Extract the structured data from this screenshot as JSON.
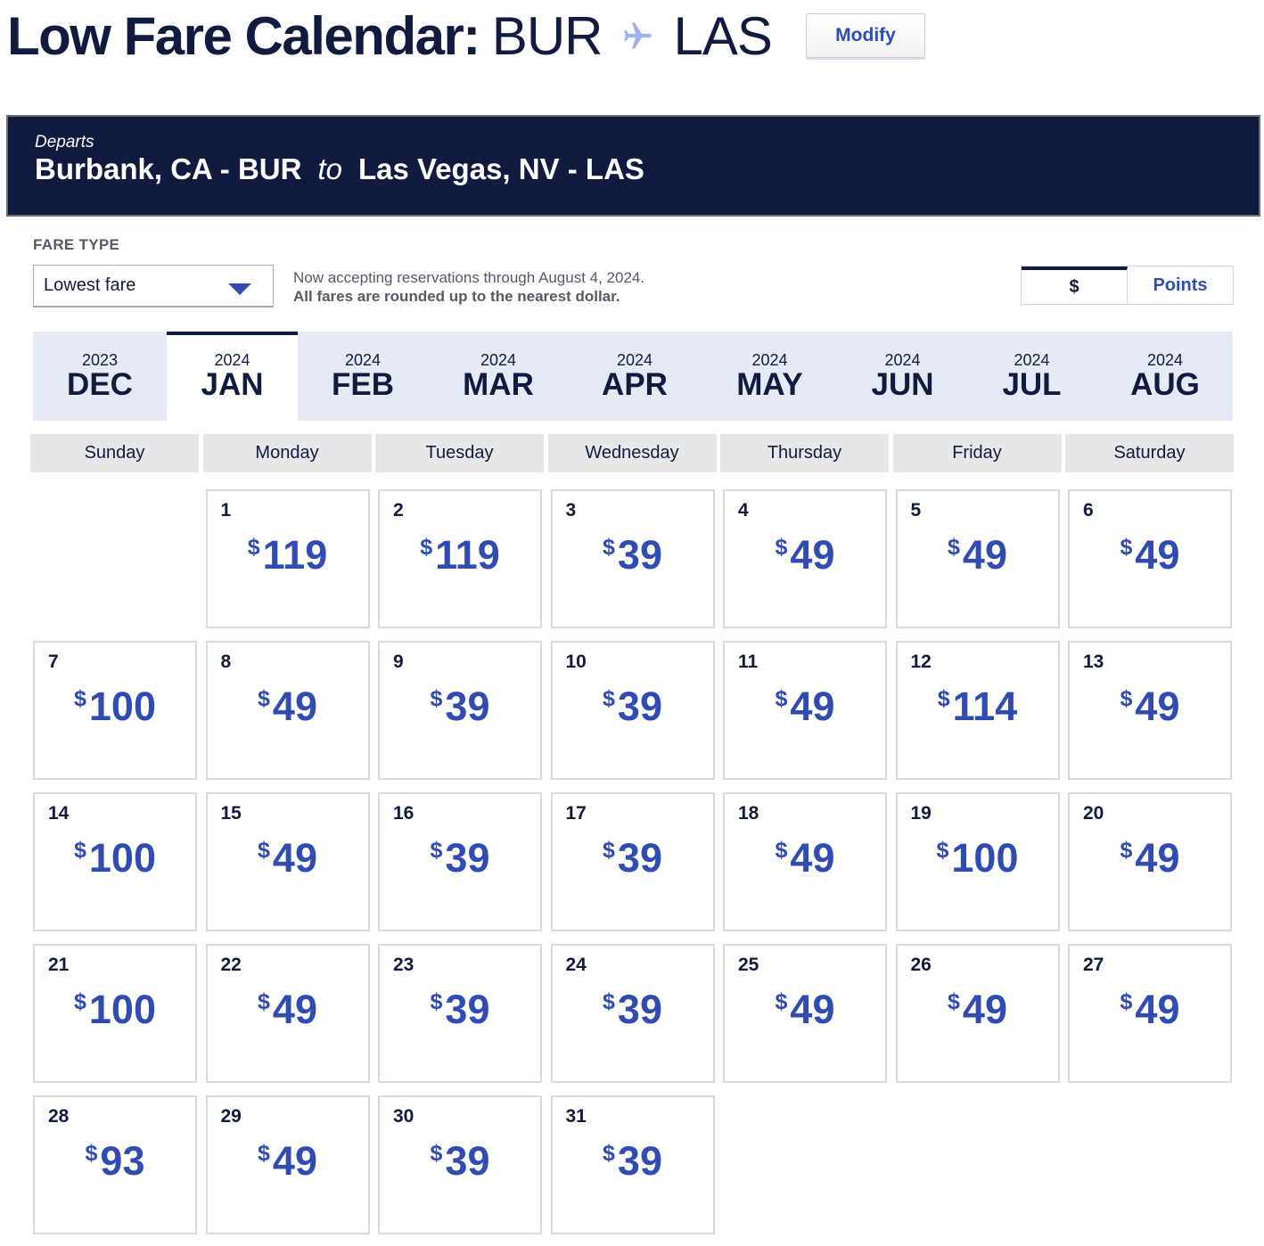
{
  "header": {
    "title_prefix": "Low Fare Calendar:",
    "origin_code": "BUR",
    "destination_code": "LAS",
    "modify_label": "Modify"
  },
  "banner": {
    "departs_label": "Departs",
    "origin": "Burbank, CA - BUR",
    "to_word": "to",
    "destination": "Las Vegas, NV - LAS"
  },
  "fare_type": {
    "label": "FARE TYPE",
    "selected": "Lowest fare"
  },
  "notice": {
    "line1": "Now accepting reservations through August 4, 2024.",
    "line2": "All fares are rounded up to the nearest dollar."
  },
  "currency_toggle": {
    "dollars_label": "$",
    "points_label": "Points",
    "selected": "$"
  },
  "months": [
    {
      "year": "2023",
      "month": "DEC",
      "active": false
    },
    {
      "year": "2024",
      "month": "JAN",
      "active": true
    },
    {
      "year": "2024",
      "month": "FEB",
      "active": false
    },
    {
      "year": "2024",
      "month": "MAR",
      "active": false
    },
    {
      "year": "2024",
      "month": "APR",
      "active": false
    },
    {
      "year": "2024",
      "month": "MAY",
      "active": false
    },
    {
      "year": "2024",
      "month": "JUN",
      "active": false
    },
    {
      "year": "2024",
      "month": "JUL",
      "active": false
    },
    {
      "year": "2024",
      "month": "AUG",
      "active": false
    }
  ],
  "weekdays": [
    "Sunday",
    "Monday",
    "Tuesday",
    "Wednesday",
    "Thursday",
    "Friday",
    "Saturday"
  ],
  "calendar": {
    "currency_symbol": "$",
    "first_weekday_index": 1,
    "days": [
      {
        "day": "1",
        "fare": "119"
      },
      {
        "day": "2",
        "fare": "119"
      },
      {
        "day": "3",
        "fare": "39"
      },
      {
        "day": "4",
        "fare": "49"
      },
      {
        "day": "5",
        "fare": "49"
      },
      {
        "day": "6",
        "fare": "49"
      },
      {
        "day": "7",
        "fare": "100"
      },
      {
        "day": "8",
        "fare": "49"
      },
      {
        "day": "9",
        "fare": "39"
      },
      {
        "day": "10",
        "fare": "39"
      },
      {
        "day": "11",
        "fare": "49"
      },
      {
        "day": "12",
        "fare": "114"
      },
      {
        "day": "13",
        "fare": "49"
      },
      {
        "day": "14",
        "fare": "100"
      },
      {
        "day": "15",
        "fare": "49"
      },
      {
        "day": "16",
        "fare": "39"
      },
      {
        "day": "17",
        "fare": "39"
      },
      {
        "day": "18",
        "fare": "49"
      },
      {
        "day": "19",
        "fare": "100"
      },
      {
        "day": "20",
        "fare": "49"
      },
      {
        "day": "21",
        "fare": "100"
      },
      {
        "day": "22",
        "fare": "49"
      },
      {
        "day": "23",
        "fare": "39"
      },
      {
        "day": "24",
        "fare": "39"
      },
      {
        "day": "25",
        "fare": "49"
      },
      {
        "day": "26",
        "fare": "49"
      },
      {
        "day": "27",
        "fare": "49"
      },
      {
        "day": "28",
        "fare": "93"
      },
      {
        "day": "29",
        "fare": "49"
      },
      {
        "day": "30",
        "fare": "39"
      },
      {
        "day": "31",
        "fare": "39"
      }
    ]
  },
  "colors": {
    "navy": "#111b40",
    "fare_blue": "#304cb2",
    "plane_icon": "#9fb1ea",
    "month_tab_bg": "#e6eaf7"
  }
}
